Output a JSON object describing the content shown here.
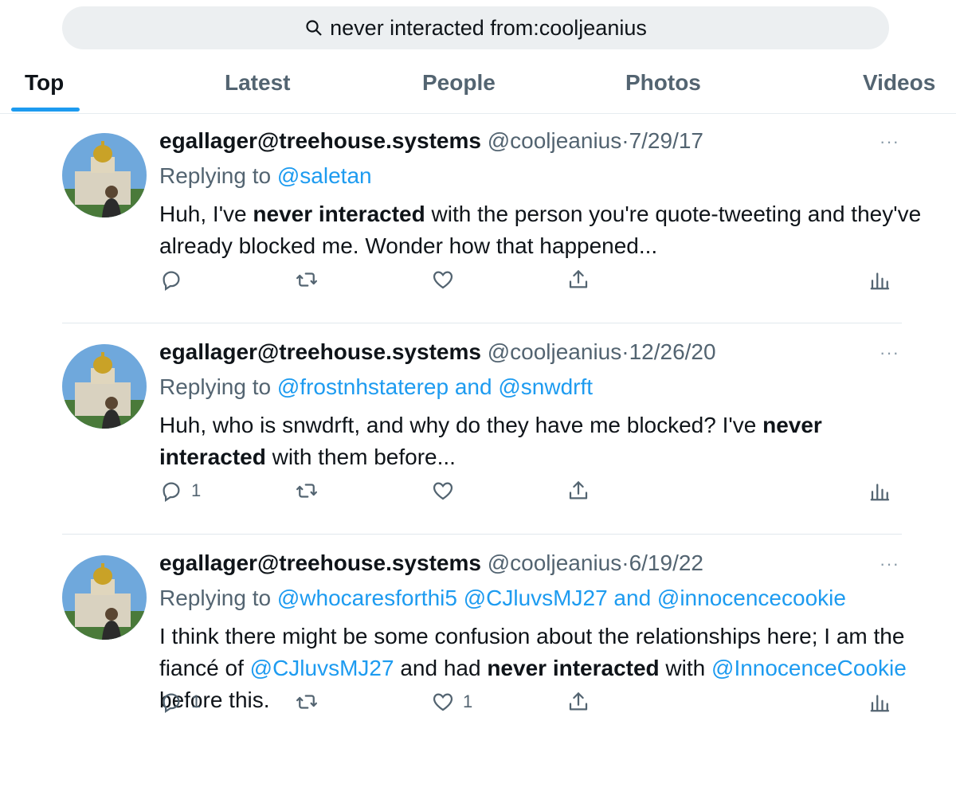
{
  "search": {
    "query": "never interacted from:cooljeanius"
  },
  "tabs": [
    "Top",
    "Latest",
    "People",
    "Photos",
    "Videos"
  ],
  "tweets": [
    {
      "name": "egallager@treehouse.systems",
      "handle": "@cooljeanius",
      "dot": "·",
      "date": "7/29/17",
      "more": "···",
      "replying_prefix": "Replying to",
      "replying_links": "@saletan",
      "body": [
        {
          "t": "Huh, I've "
        },
        {
          "t": "never interacted",
          "b": true
        },
        {
          "t": " with the person you're quote-tweeting and they've already blocked me. Wonder how that happened..."
        }
      ],
      "reply_count": "",
      "like_count": ""
    },
    {
      "name": "egallager@treehouse.systems",
      "handle": "@cooljeanius",
      "dot": "·",
      "date": "12/26/20",
      "more": "···",
      "replying_prefix": "Replying to",
      "replying_links": "@frostnhstaterep and @snwdrft",
      "body": [
        {
          "t": "Huh, who is snwdrft, and why do they have me blocked? I've "
        },
        {
          "t": "never interacted",
          "b": true
        },
        {
          "t": " with them before..."
        }
      ],
      "reply_count": "1",
      "like_count": ""
    },
    {
      "name": "egallager@treehouse.systems",
      "handle": "@cooljeanius",
      "dot": "·",
      "date": "6/19/22",
      "more": "···",
      "replying_prefix": "Replying to",
      "replying_links": "@whocaresforthi5 @CJluvsMJ27 and @innocencecookie",
      "body": [
        {
          "t": "I think there might be some confusion about the relationships here; I am the fiancé of "
        },
        {
          "t": "@CJluvsMJ27",
          "l": true
        },
        {
          "t": " and had "
        },
        {
          "t": "never interacted",
          "b": true
        },
        {
          "t": " with "
        },
        {
          "t": "@InnocenceCookie",
          "l": true
        },
        {
          "t": " before this."
        }
      ],
      "reply_count": "1",
      "like_count": "1"
    }
  ],
  "icons": [
    "search-icon",
    "more-icon",
    "reply-icon",
    "retweet-icon",
    "like-icon",
    "share-icon",
    "analytics-icon"
  ],
  "colors": {
    "accent": "#1d9bf0",
    "muted": "#536471",
    "text": "#0f1419",
    "search_bg": "#eceff1"
  }
}
